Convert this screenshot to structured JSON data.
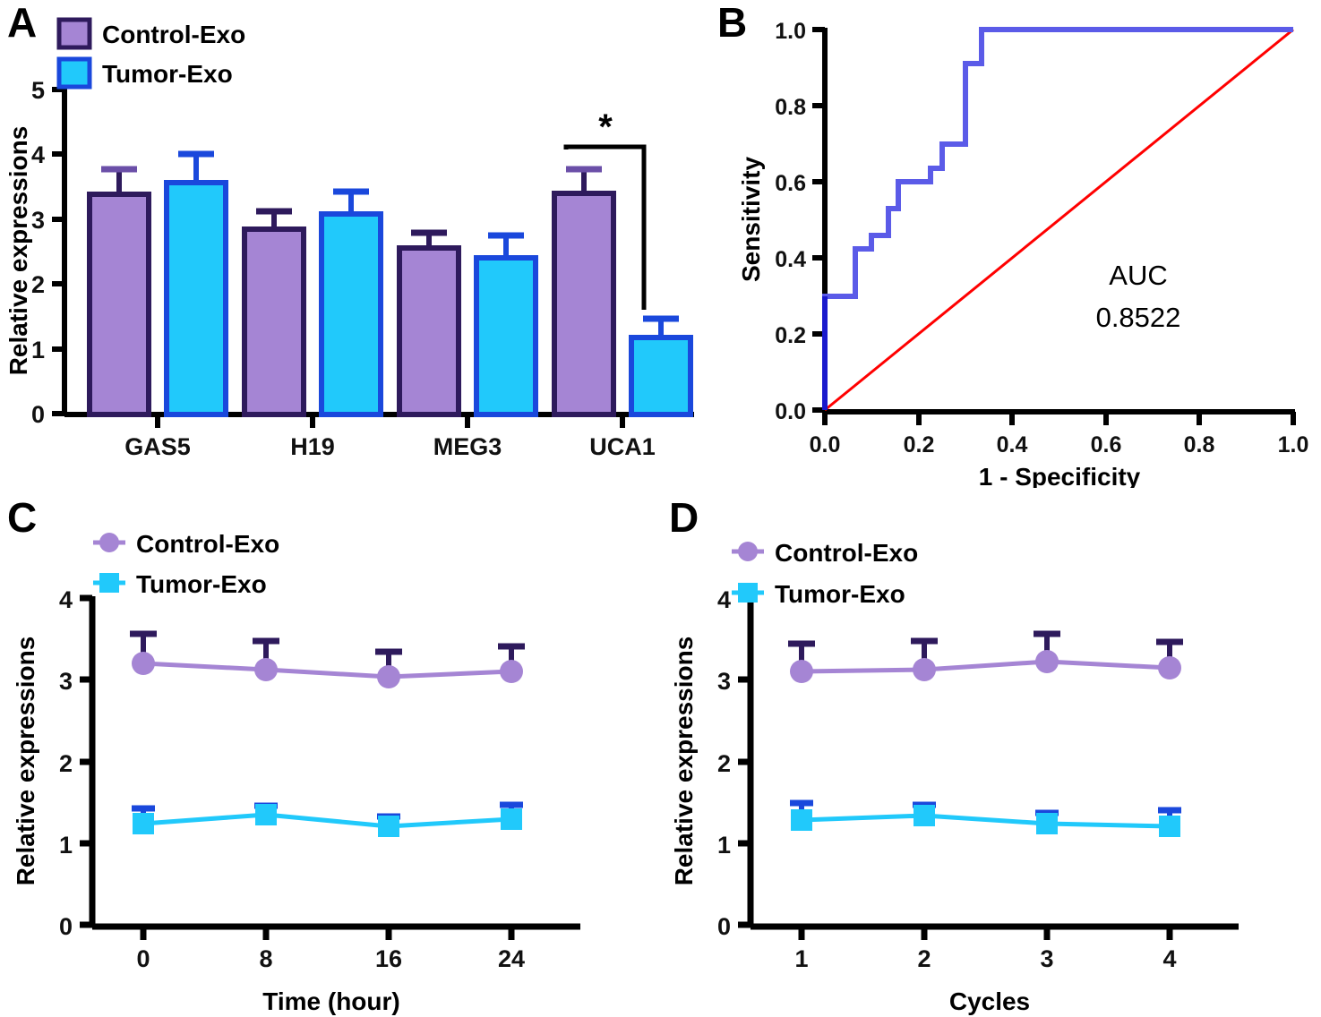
{
  "figure": {
    "panels": [
      "A",
      "B",
      "C",
      "D"
    ],
    "colors": {
      "control_fill": "#a585d4",
      "control_stroke": "#2e1a5c",
      "tumor_fill": "#21c9fb",
      "tumor_stroke": "#1a48dc",
      "roc_curve": "#5b5be8",
      "roc_diagonal": "#ff0000",
      "axis": "#000000"
    }
  },
  "panelA": {
    "letter": "A",
    "legend": [
      {
        "label": "Control-Exo",
        "swatch": "control-swatch"
      },
      {
        "label": "Tumor-Exo",
        "swatch": "tumor-swatch"
      }
    ],
    "chart_data": {
      "type": "bar",
      "title": "",
      "xlabel": "",
      "ylabel": "Relative expressions",
      "categories": [
        "GAS5",
        "H19",
        "MEG3",
        "UCA1"
      ],
      "ylim": [
        0,
        5
      ],
      "yticks": [
        "0",
        "1",
        "2",
        "3",
        "4",
        "5"
      ],
      "grid": false,
      "legend_position": "top-left",
      "series": [
        {
          "name": "Control-Exo",
          "values": [
            3.39,
            2.85,
            2.55,
            3.4
          ],
          "errors": [
            0.35,
            0.26,
            0.22,
            0.35
          ]
        },
        {
          "name": "Tumor-Exo",
          "values": [
            3.57,
            3.09,
            2.4,
            1.18
          ],
          "errors": [
            0.39,
            0.31,
            0.33,
            0.21
          ]
        }
      ],
      "annotations": [
        {
          "type": "significance-bracket",
          "label": "*",
          "from": "UCA1 Control-Exo",
          "to": "UCA1 Tumor-Exo"
        }
      ]
    }
  },
  "panelB": {
    "letter": "B",
    "auc_label": "AUC",
    "auc_value": "0.8522",
    "chart_data": {
      "type": "line",
      "title": "",
      "xlabel": "1 - Specificity",
      "ylabel": "Sensitivity",
      "xlim": [
        0.0,
        1.0
      ],
      "ylim": [
        0.0,
        1.0
      ],
      "xticks": [
        "0.0",
        "0.2",
        "0.4",
        "0.6",
        "0.8",
        "1.0"
      ],
      "yticks": [
        "0.0",
        "0.2",
        "0.4",
        "0.6",
        "0.8",
        "1.0"
      ],
      "grid": false,
      "series": [
        {
          "name": "ROC curve",
          "color": "#5b5be8",
          "x": [
            0.0,
            0.0,
            0.065,
            0.065,
            0.1,
            0.1,
            0.135,
            0.135,
            0.175,
            0.175,
            0.225,
            0.225,
            0.25,
            0.25,
            0.3,
            0.3,
            0.335,
            0.335,
            1.0
          ],
          "y": [
            0.0,
            0.3,
            0.3,
            0.425,
            0.425,
            0.46,
            0.46,
            0.53,
            0.53,
            0.6,
            0.6,
            0.635,
            0.635,
            0.7,
            0.7,
            0.91,
            0.91,
            1.0,
            1.0
          ]
        },
        {
          "name": "Reference diagonal",
          "color": "#ff0000",
          "x": [
            0.0,
            1.0
          ],
          "y": [
            0.0,
            1.0
          ]
        }
      ]
    }
  },
  "panelC": {
    "letter": "C",
    "legend": [
      {
        "label": "Control-Exo",
        "marker": "circle"
      },
      {
        "label": "Tumor-Exo",
        "marker": "square"
      }
    ],
    "chart_data": {
      "type": "line",
      "title": "",
      "xlabel": "Time (hour)",
      "ylabel": "Relative expressions",
      "categories": [
        "0",
        "8",
        "16",
        "24"
      ],
      "ylim": [
        0,
        4
      ],
      "yticks": [
        "0",
        "1",
        "2",
        "3",
        "4"
      ],
      "grid": false,
      "legend_position": "top-left",
      "series": [
        {
          "name": "Control-Exo",
          "marker": "circle",
          "values": [
            3.2,
            3.12,
            3.04,
            3.1
          ],
          "errors": [
            0.36,
            0.35,
            0.31,
            0.31
          ]
        },
        {
          "name": "Tumor-Exo",
          "marker": "square",
          "values": [
            1.24,
            1.35,
            1.2,
            1.29
          ],
          "errors": [
            0.19,
            0.11,
            0.12,
            0.17
          ]
        }
      ]
    }
  },
  "panelD": {
    "letter": "D",
    "legend": [
      {
        "label": "Control-Exo",
        "marker": "circle"
      },
      {
        "label": "Tumor-Exo",
        "marker": "square"
      }
    ],
    "chart_data": {
      "type": "line",
      "title": "",
      "xlabel": "Cycles",
      "ylabel": "Relative expressions",
      "categories": [
        "1",
        "2",
        "3",
        "4"
      ],
      "ylim": [
        0,
        4
      ],
      "yticks": [
        "0",
        "1",
        "2",
        "3",
        "4"
      ],
      "grid": false,
      "legend_position": "top-left",
      "series": [
        {
          "name": "Control-Exo",
          "marker": "circle",
          "values": [
            3.1,
            3.13,
            3.22,
            3.14
          ],
          "errors": [
            0.34,
            0.35,
            0.34,
            0.32
          ]
        },
        {
          "name": "Tumor-Exo",
          "marker": "square",
          "values": [
            1.28,
            1.34,
            1.24,
            1.21
          ],
          "errors": [
            0.21,
            0.13,
            0.13,
            0.2
          ]
        }
      ]
    }
  }
}
